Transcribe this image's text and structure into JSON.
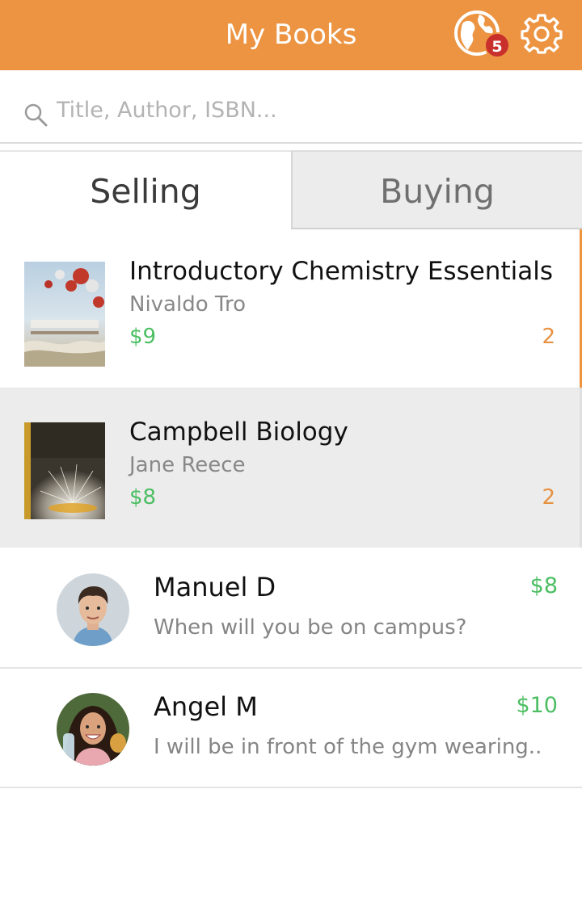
{
  "header": {
    "title": "My Books",
    "notification_count": "5",
    "globe_icon": "globe-icon",
    "settings_icon": "gear-icon"
  },
  "search": {
    "placeholder": "Title, Author, ISBN..."
  },
  "tabs": [
    {
      "label": "Selling",
      "active": true
    },
    {
      "label": "Buying",
      "active": false
    }
  ],
  "books": [
    {
      "title": "Introductory Chemistry Essentials",
      "author": "Nivaldo Tro",
      "price": "$9",
      "count": "2"
    },
    {
      "title": "Campbell Biology",
      "author": "Jane Reece",
      "price": "$8",
      "count": "2"
    }
  ],
  "messages": [
    {
      "name": "Manuel D",
      "preview": "When will you be on campus?",
      "price": "$8"
    },
    {
      "name": "Angel M",
      "preview": "I will be in front of the gym wearing..",
      "price": "$10"
    }
  ],
  "colors": {
    "accent": "#ec9442",
    "price_green": "#4cbe62",
    "count_orange": "#e7913f",
    "badge_red": "#c9302c"
  }
}
